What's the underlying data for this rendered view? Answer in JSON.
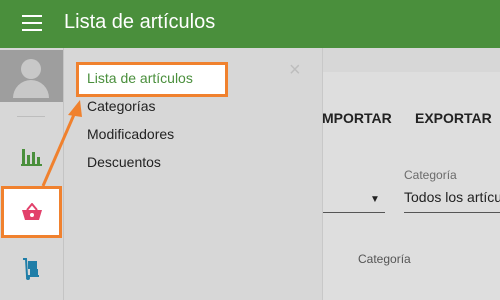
{
  "app": {
    "title": "Lista de artículos"
  },
  "icons": {
    "menu": "hamburger-menu-icon",
    "avatar": "user-avatar-icon",
    "reports": "bar-chart-icon",
    "items": "basket-icon",
    "inventory": "hand-truck-icon",
    "close": "close-icon"
  },
  "colors": {
    "topbar": "#4a8f3c",
    "accent_green": "#4a8f3c",
    "highlight": "#f0812e",
    "basket": "#e2416b"
  },
  "drawer": {
    "items": [
      {
        "label": "Lista de artículos",
        "active": true
      },
      {
        "label": "Categorías",
        "active": false
      },
      {
        "label": "Modificadores",
        "active": false
      },
      {
        "label": "Descuentos",
        "active": false
      }
    ],
    "close_symbol": "×"
  },
  "toolbar": {
    "import_label": "MPORTAR",
    "export_label": "EXPORTAR"
  },
  "filters": {
    "dropdown_symbol": "▼",
    "category_label": "Categoría",
    "category_value": "Todos los artícu"
  },
  "table": {
    "columns": [
      "Categoría"
    ]
  }
}
